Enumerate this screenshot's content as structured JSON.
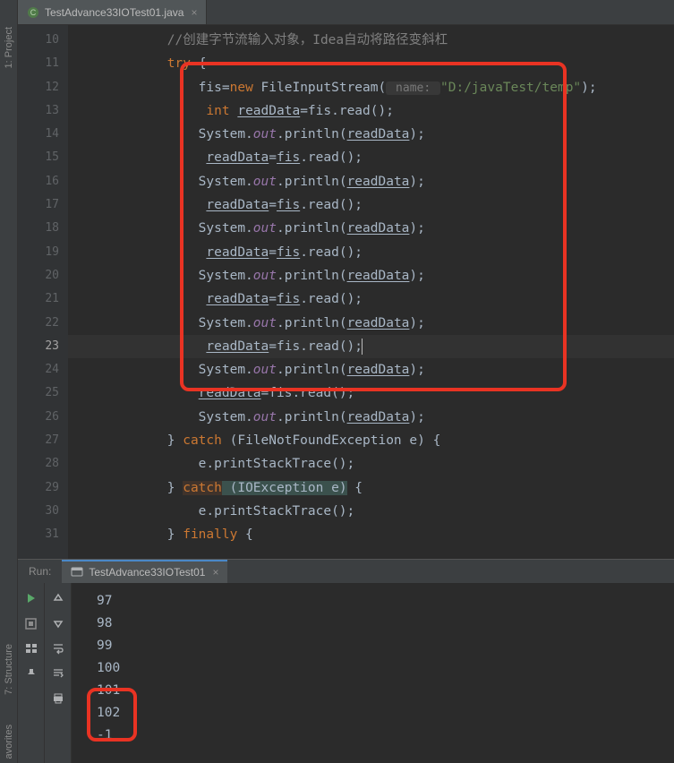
{
  "sidebar": {
    "project_label": "1: Project",
    "structure_label": "7: Structure",
    "favorites_label": "avorites"
  },
  "tab": {
    "filename": "TestAdvance33IOTest01.java"
  },
  "gutter": {
    "lines": [
      "10",
      "11",
      "12",
      "13",
      "14",
      "15",
      "16",
      "17",
      "18",
      "19",
      "20",
      "21",
      "22",
      "23",
      "24",
      "25",
      "26",
      "27",
      "28",
      "29",
      "30",
      "31"
    ],
    "active": "23"
  },
  "code": {
    "l10_indent": "            ",
    "l10_comment": "//创建字节流输入对象，Idea自动将路径变斜杠",
    "l11_indent": "            ",
    "l11_try": "try",
    "l11_brace": " {",
    "l12_indent": "                fis=",
    "l12_new": "new",
    "l12_cls": " FileInputStream(",
    "l12_hint": " name: ",
    "l12_str": "\"D:/javaTest/temp\"",
    "l12_end": ");",
    "l13_indent": "                 ",
    "l13_int": "int",
    "l13_sp": " ",
    "l13_rd": "readData",
    "l13_eq": "=fis.read();",
    "sys_indent": "                System.",
    "out": "out",
    "println": ".println(",
    "rd": "readData",
    "close_stmt": ");",
    "rd_indent": "                 ",
    "rd_eq_fis": "=",
    "rd_fis": "fis",
    "rd_read": ".read();",
    "l25_indent": "                ",
    "l27_indent": "            } ",
    "l27_catch": "catch",
    "l27_open": " (FileNotFoundException e) {",
    "l28_indent": "                e.printStackTrace();",
    "l29_indent": "            } ",
    "l29_catch": "catch",
    "l29_param": " (IOException e)",
    "l29_brace": " {",
    "l31_indent": "            } ",
    "l31_finally": "finally",
    "l31_brace": " {"
  },
  "run": {
    "label": "Run:",
    "tab_name": "TestAdvance33IOTest01",
    "output": [
      "97",
      "98",
      "99",
      "100",
      "101",
      "102",
      "-1"
    ]
  }
}
